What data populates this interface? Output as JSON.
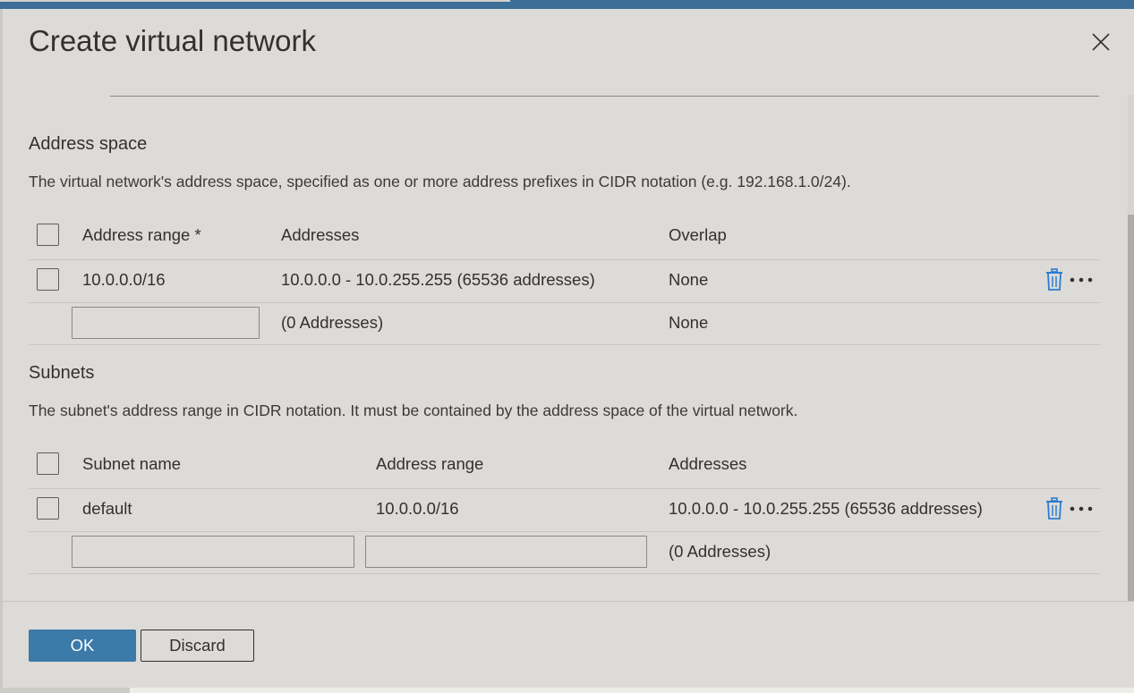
{
  "dialog": {
    "title": "Create virtual network",
    "close_icon": "close-icon"
  },
  "address_space": {
    "heading": "Address space",
    "description": "The virtual network's address space, specified as one or more address prefixes in CIDR notation (e.g. 192.168.1.0/24).",
    "columns": {
      "address_range": "Address range *",
      "addresses": "Addresses",
      "overlap": "Overlap"
    },
    "rows": [
      {
        "address_range": "10.0.0.0/16",
        "addresses": "10.0.0.0 - 10.0.255.255 (65536 addresses)",
        "overlap": "None"
      }
    ],
    "new_row": {
      "address_range_value": "",
      "addresses": "(0 Addresses)",
      "overlap": "None"
    }
  },
  "subnets": {
    "heading": "Subnets",
    "description": "The subnet's address range in CIDR notation. It must be contained by the address space of the virtual network.",
    "columns": {
      "subnet_name": "Subnet name",
      "address_range": "Address range",
      "addresses": "Addresses"
    },
    "rows": [
      {
        "subnet_name": "default",
        "address_range": "10.0.0.0/16",
        "addresses": "10.0.0.0 - 10.0.255.255 (65536 addresses)"
      }
    ],
    "new_row": {
      "subnet_name_value": "",
      "address_range_value": "",
      "addresses": "(0 Addresses)"
    }
  },
  "footer": {
    "ok_label": "OK",
    "discard_label": "Discard"
  },
  "colors": {
    "primary": "#3b7aa9",
    "topbar": "#3c6e98",
    "icon_blue": "#2b7cd3",
    "background": "#dddbd7"
  },
  "icons": [
    "close-icon",
    "trash-icon",
    "more-icon"
  ]
}
